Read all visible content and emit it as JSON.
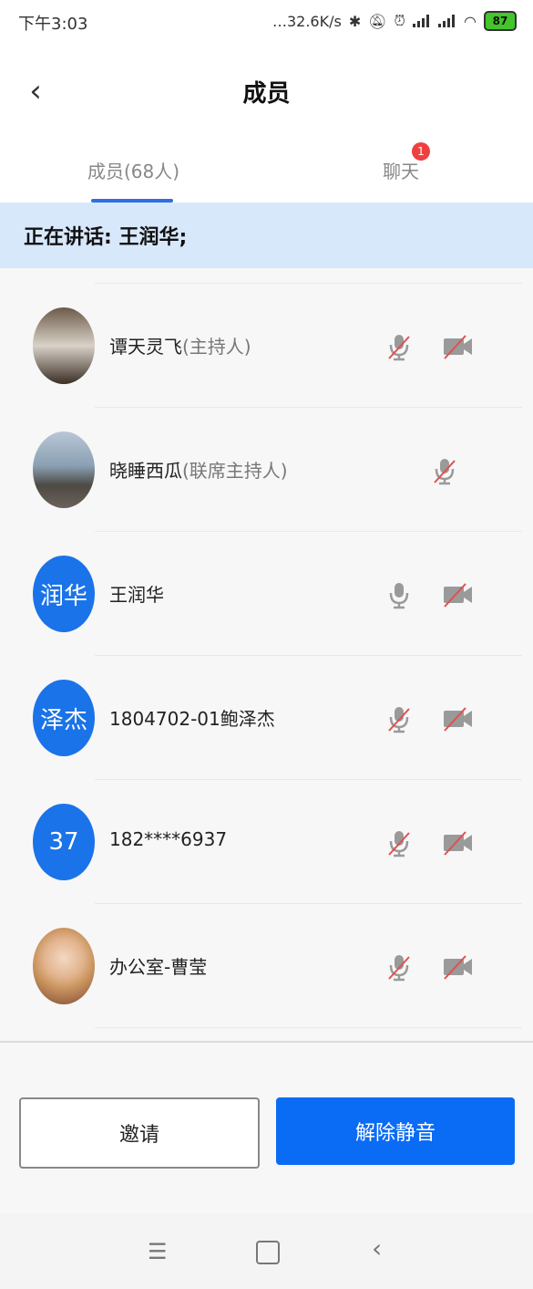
{
  "status_bar": {
    "time": "下午3:03",
    "network_speed": "32.6K/s",
    "battery": "87"
  },
  "header": {
    "title": "成员"
  },
  "tabs": [
    {
      "label": "成员(68人)"
    },
    {
      "label": "聊天",
      "badge": "1"
    }
  ],
  "speaking": {
    "text": "正在讲话: 王润华;"
  },
  "members": [
    {
      "name": "谭天灵飞",
      "role": "(主持人)",
      "avatar_text": "",
      "avatar": "photo",
      "mic": "muted",
      "camera": "off"
    },
    {
      "name": "晓睡西瓜",
      "role": "(联席主持人)",
      "avatar_text": "",
      "avatar": "photo",
      "mic": "muted",
      "camera": "none"
    },
    {
      "name": "王润华",
      "role": "",
      "avatar_text": "润华",
      "avatar": "blue",
      "mic": "on",
      "camera": "off"
    },
    {
      "name": "1804702-01鲍泽杰",
      "role": "",
      "avatar_text": "泽杰",
      "avatar": "blue",
      "mic": "muted",
      "camera": "off"
    },
    {
      "name": "182****6937",
      "role": "",
      "avatar_text": "37",
      "avatar": "blue",
      "mic": "muted",
      "camera": "off"
    },
    {
      "name": "办公室-曹莹",
      "role": "",
      "avatar_text": "",
      "avatar": "photo",
      "mic": "muted",
      "camera": "off"
    }
  ],
  "footer": {
    "invite_label": "邀请",
    "unmute_label": "解除静音"
  },
  "colors": {
    "accent": "#0a6cf5",
    "banner": "#d8e8fb",
    "badge": "#ef4040",
    "mute_slash": "#e05050"
  }
}
